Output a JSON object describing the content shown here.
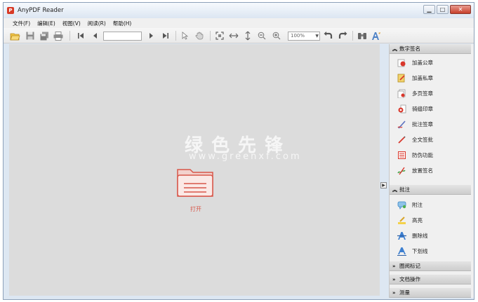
{
  "window": {
    "title": "AnyPDF Reader",
    "app_icon": "P"
  },
  "window_controls": {
    "minimize": "▁",
    "maximize": "□",
    "close": "✕"
  },
  "menu": [
    {
      "label": "文件(F)"
    },
    {
      "label": "编辑(E)"
    },
    {
      "label": "视图(V)"
    },
    {
      "label": "阅读(R)"
    },
    {
      "label": "帮助(H)"
    }
  ],
  "toolbar": {
    "page_value": "",
    "zoom": "100%"
  },
  "watermark": {
    "text": "绿色先锋",
    "url": "www.greenxf.com"
  },
  "canvas": {
    "open_label": "打开"
  },
  "panel": {
    "sections": [
      {
        "title": "数字签名",
        "expanded": true,
        "items": [
          {
            "label": "加盖公章",
            "icon": "stamp-icon"
          },
          {
            "label": "加盖私章",
            "icon": "private-seal-icon"
          },
          {
            "label": "多页签章",
            "icon": "multi-page-seal-icon"
          },
          {
            "label": "骑缝印章",
            "icon": "seam-seal-icon"
          },
          {
            "label": "批注签章",
            "icon": "annotation-seal-icon"
          },
          {
            "label": "全文签批",
            "icon": "pen-sign-icon"
          },
          {
            "label": "防伪功能",
            "icon": "anti-fake-icon"
          },
          {
            "label": "放置签名",
            "icon": "place-signature-icon"
          }
        ]
      },
      {
        "title": "批注",
        "expanded": true,
        "items": [
          {
            "label": "附注",
            "icon": "note-icon"
          },
          {
            "label": "高亮",
            "icon": "highlight-icon"
          },
          {
            "label": "删除线",
            "icon": "strikethrough-icon"
          },
          {
            "label": "下划线",
            "icon": "underline-icon"
          }
        ]
      },
      {
        "title": "圈阅标记",
        "expanded": false
      },
      {
        "title": "文档操作",
        "expanded": false
      },
      {
        "title": "测量",
        "expanded": false
      }
    ]
  },
  "colors": {
    "accent": "#d8574a",
    "canvas_bg": "#dcdcdc",
    "panel_bg": "#f0f0f0"
  }
}
